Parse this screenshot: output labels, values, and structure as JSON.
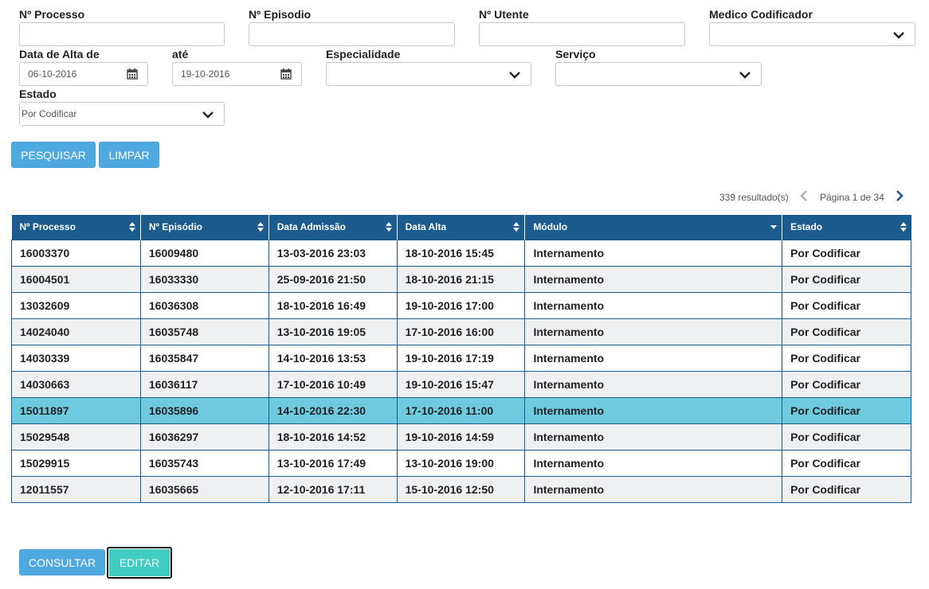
{
  "filters": {
    "processo": {
      "label": "Nº Processo",
      "value": ""
    },
    "episodio": {
      "label": "Nº Episodio",
      "value": ""
    },
    "utente": {
      "label": "Nº Utente",
      "value": ""
    },
    "medico": {
      "label": "Medico Codificador",
      "value": ""
    },
    "data_alta_de": {
      "label": "Data de Alta de",
      "value": "06-10-2016"
    },
    "ate": {
      "label": "até",
      "value": "19-10-2016"
    },
    "especialidade": {
      "label": "Especialidade",
      "value": ""
    },
    "servico": {
      "label": "Serviço",
      "value": ""
    },
    "estado": {
      "label": "Estado",
      "value": "Por Codificar"
    }
  },
  "actions": {
    "pesquisar": "PESQUISAR",
    "limpar": "LIMPAR",
    "consultar": "CONSULTAR",
    "editar": "EDITAR"
  },
  "pagination": {
    "results": "339 resultado(s)",
    "page": "Página 1 de 34"
  },
  "colors": {
    "header": "#1b5b8d",
    "button": "#4ea9de",
    "selected_row": "#6ecbdf",
    "edit_button": "#42cbc0"
  },
  "table": {
    "headers": [
      "Nº Processo",
      "Nº Episódio",
      "Data Admissão",
      "Data Alta",
      "Módulo",
      "Estado"
    ],
    "rows": [
      [
        "16003370",
        "16009480",
        "13-03-2016 23:03",
        "18-10-2016 15:45",
        "Internamento",
        "Por Codificar"
      ],
      [
        "16004501",
        "16033330",
        "25-09-2016 21:50",
        "18-10-2016 21:15",
        "Internamento",
        "Por Codificar"
      ],
      [
        "13032609",
        "16036308",
        "18-10-2016 16:49",
        "19-10-2016 17:00",
        "Internamento",
        "Por Codificar"
      ],
      [
        "14024040",
        "16035748",
        "13-10-2016 19:05",
        "17-10-2016 16:00",
        "Internamento",
        "Por Codificar"
      ],
      [
        "14030339",
        "16035847",
        "14-10-2016 13:53",
        "19-10-2016 17:19",
        "Internamento",
        "Por Codificar"
      ],
      [
        "14030663",
        "16036117",
        "17-10-2016 10:49",
        "19-10-2016 15:47",
        "Internamento",
        "Por Codificar"
      ],
      [
        "15011897",
        "16035896",
        "14-10-2016 22:30",
        "17-10-2016 11:00",
        "Internamento",
        "Por Codificar"
      ],
      [
        "15029548",
        "16036297",
        "18-10-2016 14:52",
        "19-10-2016 14:59",
        "Internamento",
        "Por Codificar"
      ],
      [
        "15029915",
        "16035743",
        "13-10-2016 17:49",
        "13-10-2016 19:00",
        "Internamento",
        "Por Codificar"
      ],
      [
        "12011557",
        "16035665",
        "12-10-2016 17:11",
        "15-10-2016 12:50",
        "Internamento",
        "Por Codificar"
      ]
    ],
    "selected_row": 6
  }
}
